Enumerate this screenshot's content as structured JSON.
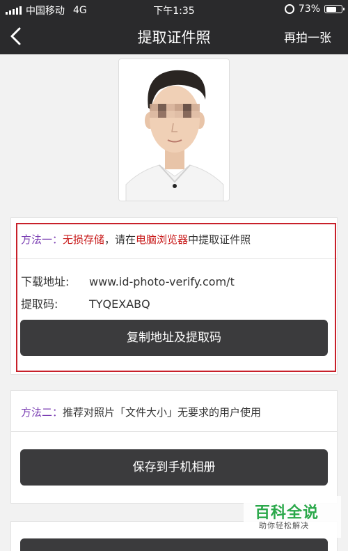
{
  "status_bar": {
    "carrier": "中国移动",
    "network": "4G",
    "time": "下午1:35",
    "battery": "73%",
    "battery_level": 0.73
  },
  "navbar": {
    "title": "提取证件照",
    "retake_label": "再拍一张"
  },
  "method1": {
    "label": "方法一：",
    "highlight1": "无损存储",
    "text1": "，请在",
    "highlight2": "电脑浏览器",
    "text2": "中提取证件照",
    "download_key": "下载地址:",
    "download_value": "www.id-photo-verify.com/t",
    "code_key": "提取码:",
    "code_value": "TYQEXABQ",
    "button_label": "复制地址及提取码"
  },
  "method2": {
    "label": "方法二：",
    "text": "推荐对照片「文件大小」无要求的用户使用",
    "button_label": "保存到手机相册"
  },
  "watermark": {
    "logo": "百科全说",
    "tagline": "助你轻松解决"
  },
  "colors": {
    "header_bg": "#2a2a2c",
    "button_bg": "#3b3b3d",
    "method_label": "#7b3fb3",
    "highlight_red": "#c81a1a",
    "annotation_box": "#c8202a"
  }
}
